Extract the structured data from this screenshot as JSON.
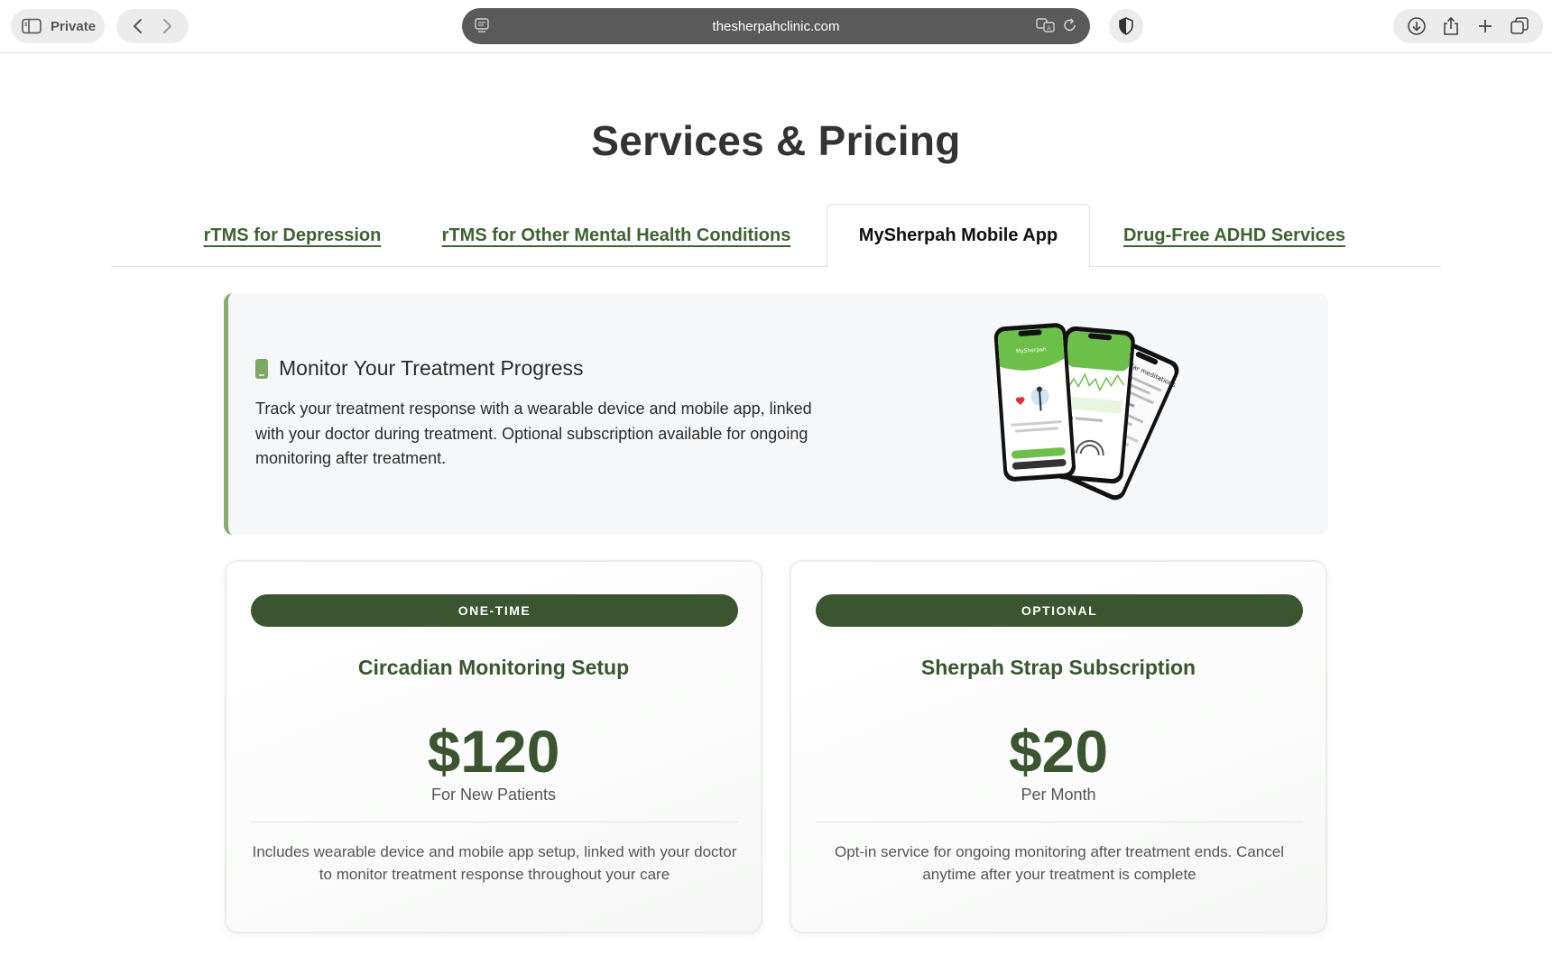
{
  "browser": {
    "private_label": "Private",
    "url": "thesherpahclinic.com"
  },
  "page": {
    "title": "Services & Pricing"
  },
  "tabs": [
    {
      "label": "rTMS for Depression",
      "active": false
    },
    {
      "label": "rTMS for Other Mental Health Conditions",
      "active": false
    },
    {
      "label": "MySherpah Mobile App",
      "active": true
    },
    {
      "label": "Drug-Free ADHD Services",
      "active": false
    }
  ],
  "feature": {
    "icon": "mobile-phone-icon",
    "title": "Monitor Your Treatment Progress",
    "text": "Track your treatment response with a wearable device and mobile app, linked with your doctor during treatment. Optional subscription available for ongoing monitoring after treatment.",
    "phone_screens": {
      "phone1_brand": "MySherpah",
      "phone3_heading": "Popular meditations"
    }
  },
  "cards": [
    {
      "badge": "ONE-TIME",
      "title": "Circadian Monitoring Setup",
      "price": "$120",
      "price_sub": "For New Patients",
      "description": "Includes wearable device and mobile app setup, linked with your doctor to monitor treatment response throughout your care"
    },
    {
      "badge": "OPTIONAL",
      "title": "Sherpah Strap Subscription",
      "price": "$20",
      "price_sub": "Per Month",
      "description": "Opt-in service for ongoing monitoring after treatment ends. Cancel anytime after your treatment is complete"
    }
  ],
  "colors": {
    "brand_dark_green": "#3a5530",
    "link_green": "#3e6231",
    "accent_green": "#8aab73",
    "app_green": "#6cc04a"
  }
}
